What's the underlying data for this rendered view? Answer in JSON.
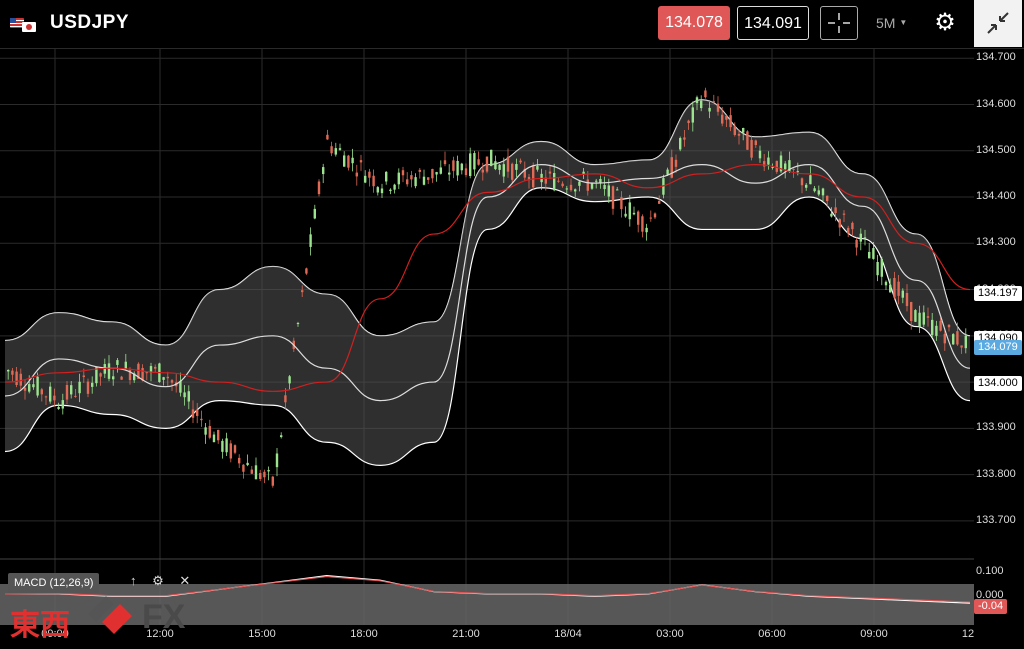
{
  "header": {
    "symbol": "USDJPY",
    "flags": [
      "us-flag",
      "jp-flag"
    ],
    "bid": "134.078",
    "ask": "134.091",
    "timeframe": "5M",
    "icons": [
      "crosshair-icon",
      "gear-icon",
      "collapse-icon"
    ],
    "colors": {
      "bid": "#e05757",
      "background": "#000000"
    }
  },
  "price_axis": {
    "ticks": [
      "134.700",
      "134.600",
      "134.500",
      "134.400",
      "134.300",
      "134.200",
      "134.100",
      "134.000",
      "133.900",
      "133.800",
      "133.700"
    ],
    "upper_band_tag": "134.197",
    "middle_tag": "134.090",
    "current_tag": "134.079",
    "lower_band_tag": "134.000",
    "current_color": "#5aa9e0"
  },
  "macd": {
    "label": "MACD (12,26,9)",
    "ticks": [
      "0.100",
      "0.000"
    ],
    "value_tag": "-0.04",
    "icons": [
      "arrow-up-icon",
      "settings-icon",
      "close-icon"
    ]
  },
  "time_axis": {
    "labels": [
      "09:00",
      "12:00",
      "15:00",
      "18:00",
      "21:00",
      "18/04",
      "03:00",
      "06:00",
      "09:00",
      "12"
    ]
  },
  "watermark": {
    "kanji": "東西",
    "text": "FX"
  },
  "chart_data": {
    "type": "line",
    "title": "USDJPY",
    "x": [
      "09:00",
      "12:00",
      "15:00",
      "18:00",
      "21:00",
      "18/04",
      "03:00",
      "06:00",
      "09:00",
      "12"
    ],
    "ylim": [
      133.65,
      134.72
    ],
    "grid": true,
    "series": [
      {
        "values": [
          134.03,
          133.96,
          134.03,
          134.02,
          133.87,
          133.78,
          134.52,
          134.43,
          134.45,
          134.48,
          134.44,
          134.43,
          134.34,
          134.62,
          134.5,
          134.43,
          134.3,
          134.14,
          134.08
        ],
        "color": "#e05757"
      },
      {
        "values": [
          133.97,
          134.05,
          134.03,
          133.99,
          134.08,
          134.1,
          134.03,
          133.96,
          134.0,
          134.4,
          134.47,
          134.43,
          134.44,
          134.47,
          134.43,
          134.47,
          134.38,
          134.22,
          134.03
        ]
      },
      {
        "values": [
          134.0,
          134.02,
          134.03,
          134.02,
          134.0,
          133.98,
          134.0,
          134.18,
          134.32,
          134.41,
          134.44,
          134.45,
          134.42,
          134.45,
          134.47,
          134.45,
          134.4,
          134.3,
          134.2
        ],
        "color": "#d02020"
      }
    ],
    "macd_series": [
      0.0,
      0.0,
      -0.01,
      -0.01,
      0.02,
      0.05,
      0.08,
      0.06,
      0.01,
      0.0,
      0.0,
      -0.01,
      0.0,
      0.04,
      0.01,
      -0.01,
      -0.02,
      -0.03,
      -0.04
    ]
  }
}
